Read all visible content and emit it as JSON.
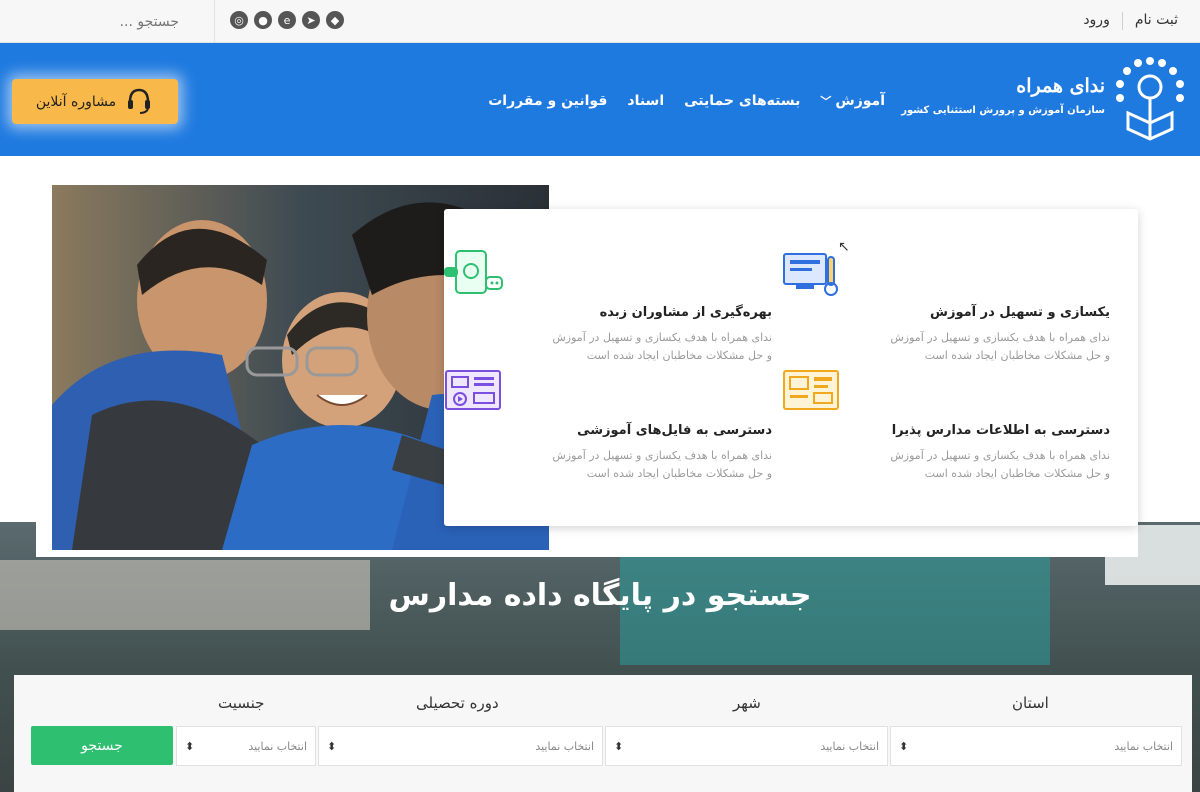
{
  "topbar": {
    "register": "ثبت نام",
    "login": "ورود",
    "search_placeholder": "جستجو ..."
  },
  "header": {
    "brand_name": "ندای همراه",
    "brand_sub": "سازمان آموزش و پرورش استثنایی کشور",
    "nav": [
      "آموزش",
      "بسته‌های حمایتی",
      "اسناد",
      "قوانین و مقررات"
    ],
    "consult_label": "مشاوره آنلاین"
  },
  "features": [
    {
      "title": "یکسازی و تسهیل در آموزش",
      "desc1": "ندای همراه با هدف یکسازی و تسهیل در آموزش",
      "desc2": "و حل مشکلات مخاطبان ایجاد شده است"
    },
    {
      "title": "بهره‌گیری از مشاوران زبده",
      "desc1": "ندای همراه با هدف یکسازی و تسهیل در آموزش",
      "desc2": "و حل مشکلات مخاطبان ایجاد شده است"
    },
    {
      "title": "دسترسی به اطلاعات مدارس پذیرا",
      "desc1": "ندای همراه با هدف یکسازی و تسهیل در آموزش",
      "desc2": "و حل مشکلات مخاطبان ایجاد شده است"
    },
    {
      "title": "دسترسی به فایل‌های آموزشی",
      "desc1": "ندای همراه با هدف یکسازی و تسهیل در آموزش",
      "desc2": "و حل مشکلات مخاطبان ایجاد شده است"
    }
  ],
  "search_section": {
    "title": "جستجو در پایگاه داده مدارس",
    "labels": {
      "province": "استان",
      "city": "شهر",
      "level": "دوره تحصیلی",
      "gender": "جنسیت"
    },
    "select_placeholder": "انتخاب نمایید",
    "button": "جستجو"
  },
  "colors": {
    "header_blue": "#1f7ae0",
    "consult_orange": "#f9b84a",
    "search_green": "#2fbf71"
  }
}
